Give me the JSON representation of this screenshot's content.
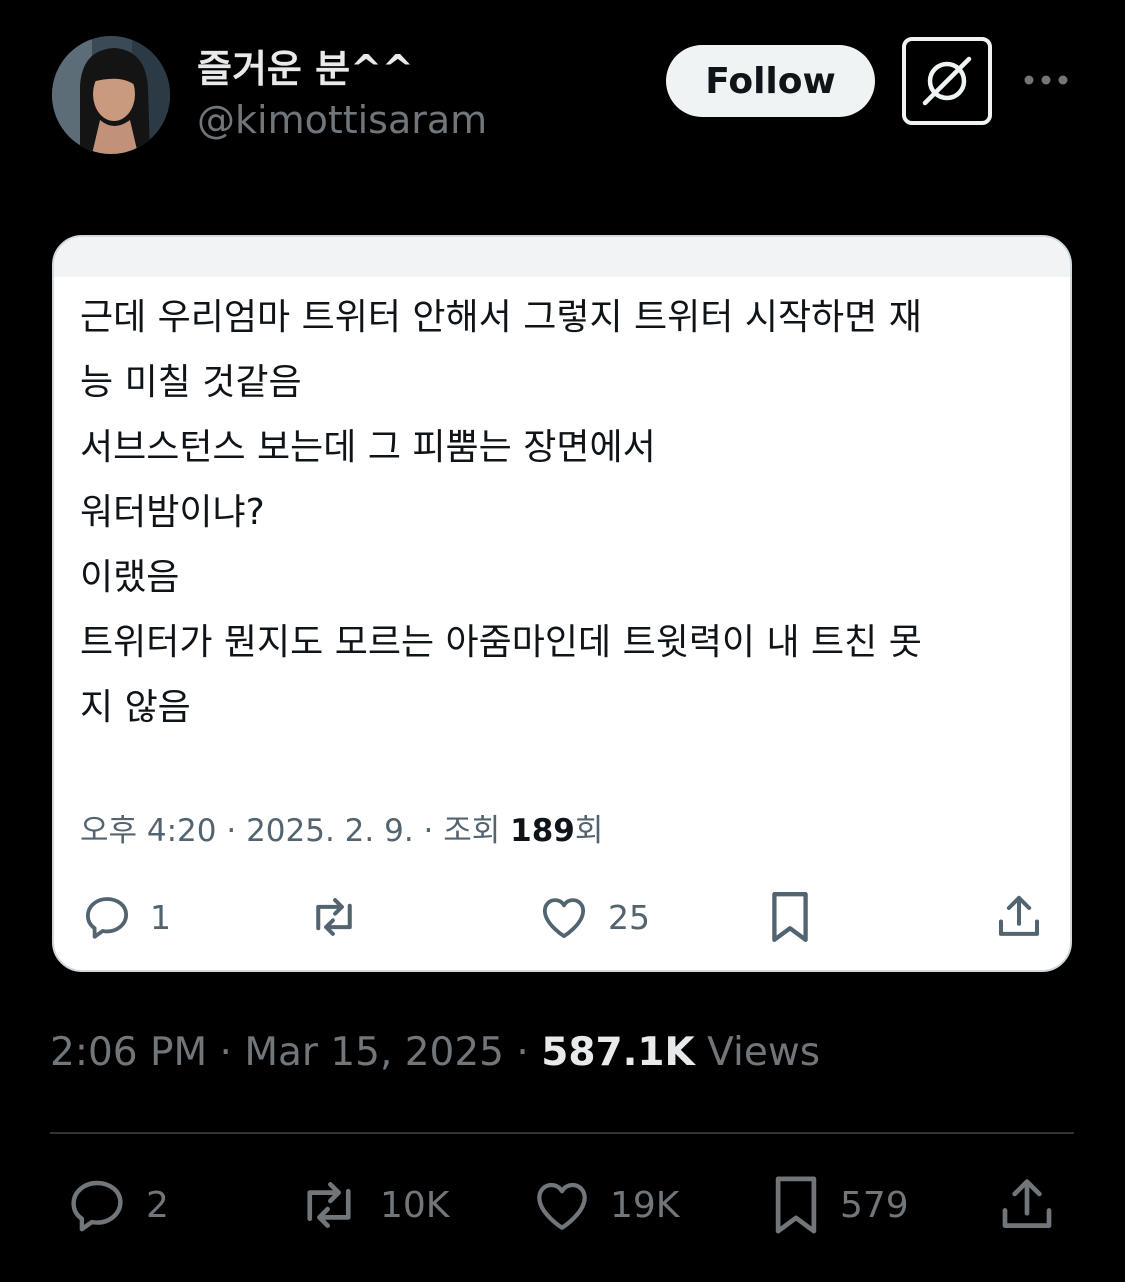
{
  "author": {
    "display_name": "즐거운 분^^",
    "handle": "@kimottisaram"
  },
  "header": {
    "follow_label": "Follow",
    "grok_icon": "grok-icon",
    "more_icon": "more-horizontal-icon"
  },
  "embedded_post": {
    "lines": [
      "근데 우리엄마 트위터 안해서 그렇지 트위터 시작하면 재",
      "능 미칠 것같음",
      "서브스턴스 보는데 그 피뿜는 장면에서",
      "워터밤이냐?",
      "이랬음",
      "트위터가 뭔지도 모르는 아줌마인데 트윗력이 내 트친 못",
      "지 않음"
    ],
    "meta_prefix": "오후 4:20 · 2025. 2. 9. · 조회 ",
    "meta_views": "189",
    "meta_suffix": "회",
    "replies": "1",
    "reposts": "",
    "likes": "25"
  },
  "post": {
    "timestamp": "2:06 PM · Mar 15, 2025 · ",
    "views_count": "587.1K",
    "views_label": " Views",
    "replies": "2",
    "reposts": "10K",
    "likes": "19K",
    "bookmarks": "579"
  },
  "colors": {
    "background": "#000000",
    "text_primary": "#e7e9ea",
    "text_secondary": "#71767b",
    "follow_bg": "#eff3f4",
    "card_bg": "#ffffff",
    "card_meta": "#536471"
  }
}
